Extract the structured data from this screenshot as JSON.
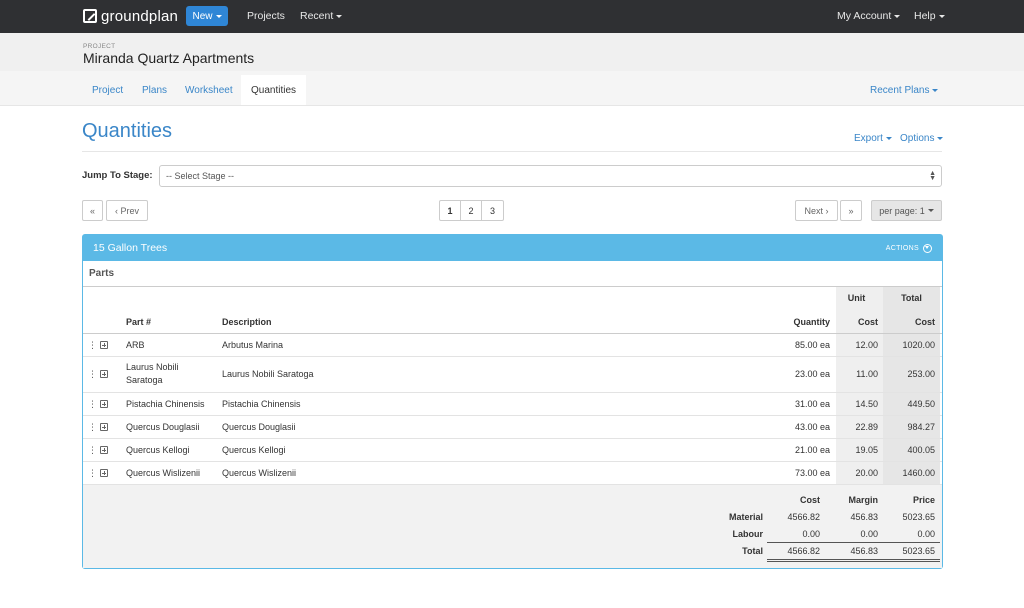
{
  "nav": {
    "brand": "groundplan",
    "new_label": "New",
    "projects_label": "Projects",
    "recent_label": "Recent",
    "account_label": "My Account",
    "help_label": "Help"
  },
  "project": {
    "label": "PROJECT",
    "name": "Miranda Quartz Apartments"
  },
  "tabs": [
    {
      "label": "Project"
    },
    {
      "label": "Plans"
    },
    {
      "label": "Worksheet"
    },
    {
      "label": "Quantities"
    }
  ],
  "recent_plans_label": "Recent Plans",
  "page": {
    "title": "Quantities",
    "export_label": "Export",
    "options_label": "Options"
  },
  "stage": {
    "label": "Jump To Stage:",
    "placeholder": "-- Select Stage --"
  },
  "pagination": {
    "first": "«",
    "prev": "‹ Prev",
    "pages": [
      "1",
      "2",
      "3"
    ],
    "next": "Next ›",
    "last": "»",
    "per_page": "per page: 1"
  },
  "panel": {
    "title": "15 Gallon Trees",
    "actions_label": "ACTIONS",
    "parts_label": "Parts",
    "headers": {
      "part": "Part #",
      "description": "Description",
      "quantity": "Quantity",
      "unit_top": "Unit",
      "unit_bottom": "Cost",
      "total_top": "Total",
      "total_bottom": "Cost"
    },
    "rows": [
      {
        "part": "ARB",
        "description": "Arbutus Marina",
        "quantity": "85.00 ea",
        "unit_cost": "12.00",
        "total_cost": "1020.00"
      },
      {
        "part": "Laurus Nobili",
        "part2": "Saratoga",
        "description": "Laurus Nobili Saratoga",
        "quantity": "23.00 ea",
        "unit_cost": "11.00",
        "total_cost": "253.00"
      },
      {
        "part": "Pistachia Chinensis",
        "description": "Pistachia Chinensis",
        "quantity": "31.00 ea",
        "unit_cost": "14.50",
        "total_cost": "449.50"
      },
      {
        "part": "Quercus Douglasii",
        "description": "Quercus Douglasii",
        "quantity": "43.00 ea",
        "unit_cost": "22.89",
        "total_cost": "984.27"
      },
      {
        "part": "Quercus Kellogi",
        "description": "Quercus Kellogi",
        "quantity": "21.00 ea",
        "unit_cost": "19.05",
        "total_cost": "400.05"
      },
      {
        "part": "Quercus Wislizenii",
        "description": "Quercus Wislizenii",
        "quantity": "73.00 ea",
        "unit_cost": "20.00",
        "total_cost": "1460.00"
      }
    ],
    "summary": {
      "headers": {
        "cost": "Cost",
        "margin": "Margin",
        "price": "Price"
      },
      "rows": [
        {
          "label": "Material",
          "cost": "4566.82",
          "margin": "456.83",
          "price": "5023.65"
        },
        {
          "label": "Labour",
          "cost": "0.00",
          "margin": "0.00",
          "price": "0.00"
        },
        {
          "label": "Total",
          "cost": "4566.82",
          "margin": "456.83",
          "price": "5023.65"
        }
      ]
    }
  }
}
